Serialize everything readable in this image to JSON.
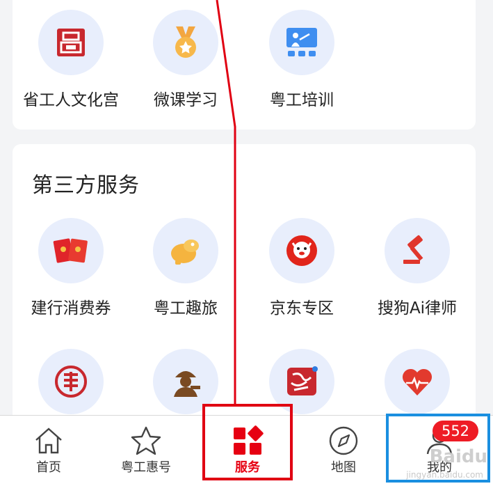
{
  "colors": {
    "accent": "#e60012",
    "annotation_red": "#e00012",
    "annotation_blue": "#1a8fe0",
    "icon_bg": "#e8eefc"
  },
  "top_services": [
    {
      "label": "省工人文化宫",
      "icon": "palace-icon"
    },
    {
      "label": "微课学习",
      "icon": "medal-icon"
    },
    {
      "label": "粤工培训",
      "icon": "training-icon"
    }
  ],
  "third_party": {
    "title": "第三方服务",
    "items": [
      {
        "label": "建行消费券",
        "icon": "red-envelope-icon"
      },
      {
        "label": "粤工趣旅",
        "icon": "travel-icon"
      },
      {
        "label": "京东专区",
        "icon": "jd-icon"
      },
      {
        "label": "搜狗Ai律师",
        "icon": "gavel-icon"
      },
      {
        "label": "",
        "icon": "seal-icon"
      },
      {
        "label": "",
        "icon": "worker-icon"
      },
      {
        "label": "",
        "icon": "calligraphy-icon"
      },
      {
        "label": "",
        "icon": "heart-pulse-icon"
      }
    ]
  },
  "nav": {
    "items": [
      {
        "label": "首页",
        "icon": "home-icon"
      },
      {
        "label": "粤工惠号",
        "icon": "star-icon"
      },
      {
        "label": "服务",
        "icon": "service-grid-icon",
        "active": true
      },
      {
        "label": "地图",
        "icon": "compass-icon"
      },
      {
        "label": "我的",
        "icon": "profile-icon"
      }
    ],
    "badge": "552"
  },
  "watermark": {
    "brand": "Baidu",
    "sub": "jingyan.baidu.com"
  }
}
